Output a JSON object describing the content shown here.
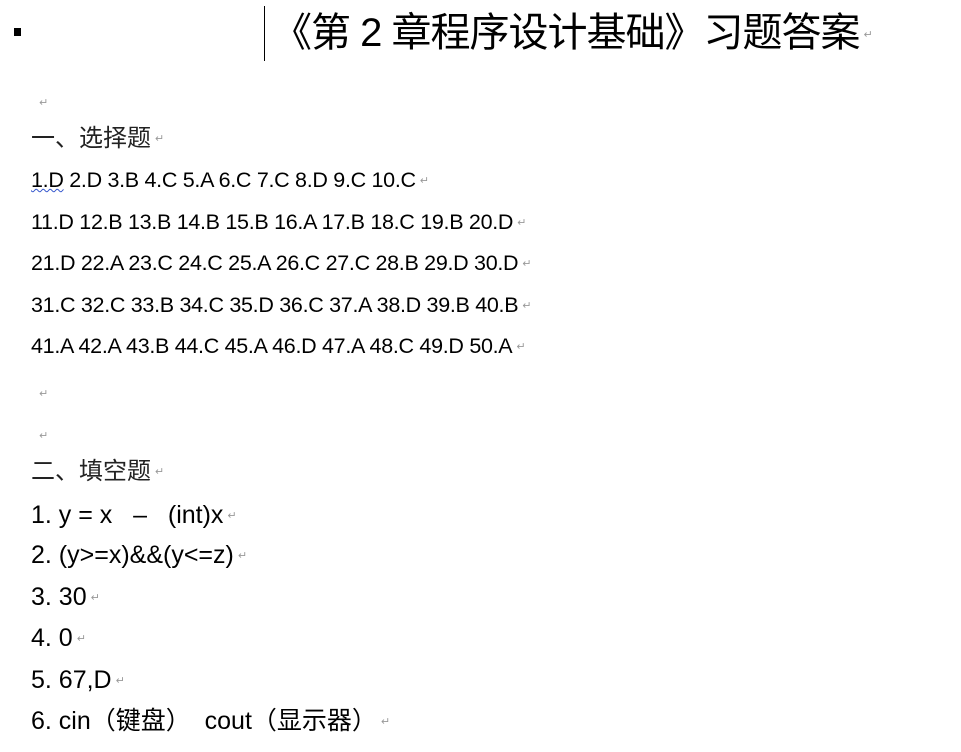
{
  "title": "《第 2 章程序设计基础》习题答案",
  "paragraph_mark": "↵",
  "section1": {
    "heading": "一、选择题",
    "first_prefix": "1.D",
    "first_rest": " 2.D 3.B 4.C 5.A 6.C 7.C 8.D 9.C 10.C",
    "rows": [
      "11.D 12.B 13.B 14.B 15.B 16.A 17.B 18.C 19.B 20.D",
      "21.D 22.A 23.C 24.C 25.A 26.C 27.C 28.B 29.D 30.D",
      "31.C 32.C 33.B 34.C 35.D 36.C 37.A 38.D 39.B 40.B",
      "41.A 42.A 43.B 44.C 45.A 46.D 47.A 48.C 49.D 50.A"
    ]
  },
  "section2": {
    "heading": "二、填空题",
    "items": [
      "1. y = x   –   (int)x",
      "2. (y>=x)&&(y<=z)",
      "3. 30",
      "4. 0",
      "5. 67,D",
      "6. cin（键盘）  cout（显示器）"
    ]
  }
}
